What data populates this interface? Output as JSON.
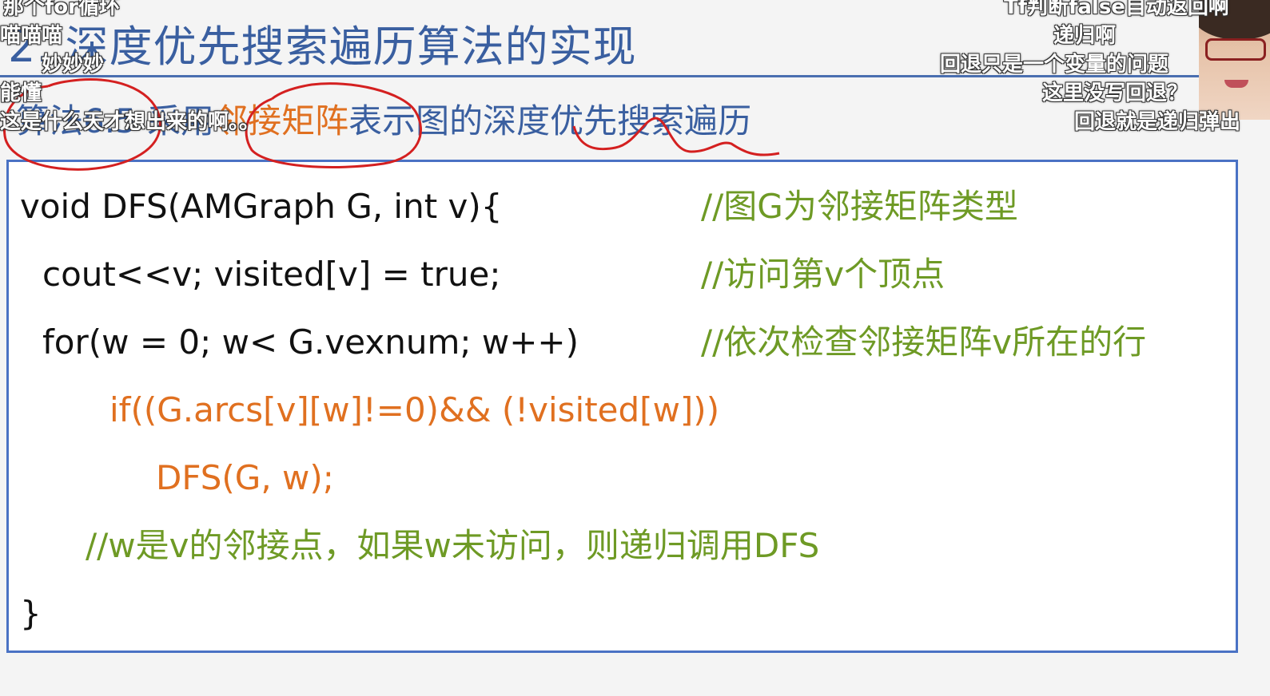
{
  "slide": {
    "title": "2. 深度优先搜索遍历算法的实现",
    "subtitle": {
      "prefix": "算法6.5 采用",
      "highlight": "邻接矩阵",
      "suffix": "表示图的深度优先搜索遍历"
    }
  },
  "code": {
    "lines": [
      {
        "code": "void DFS(AMGraph G, int v){",
        "comment": "//图G为邻接矩阵类型"
      },
      {
        "code": "cout<<v;  visited[v] = true;",
        "comment": "//访问第v个顶点"
      },
      {
        "code": "for(w = 0; w< G.vexnum; w++)",
        "comment": "//依次检查邻接矩阵v所在的行"
      },
      {
        "code": "if((G.arcs[v][w]!=0)&& (!visited[w]))",
        "comment": ""
      },
      {
        "code": "DFS(G, w);",
        "comment": ""
      },
      {
        "code": "",
        "comment": "//w是v的邻接点，如果w未访问，则递归调用DFS"
      },
      {
        "code": "}",
        "comment": ""
      }
    ]
  },
  "danmaku": [
    "那个for循环",
    "喵喵喵",
    "妙妙妙",
    "能懂",
    "这是什么天才想出来的啊。。",
    "Tf判断false自动返回啊",
    "递归啊",
    "回退只是一个变量的问题",
    "这里没写回退？",
    "回退就是递归弹出"
  ],
  "colors": {
    "title": "#3a5fa0",
    "highlight": "#e07020",
    "comment": "#6e9a25",
    "box_border": "#4a72c4",
    "annotation_ink": "#d42020"
  }
}
